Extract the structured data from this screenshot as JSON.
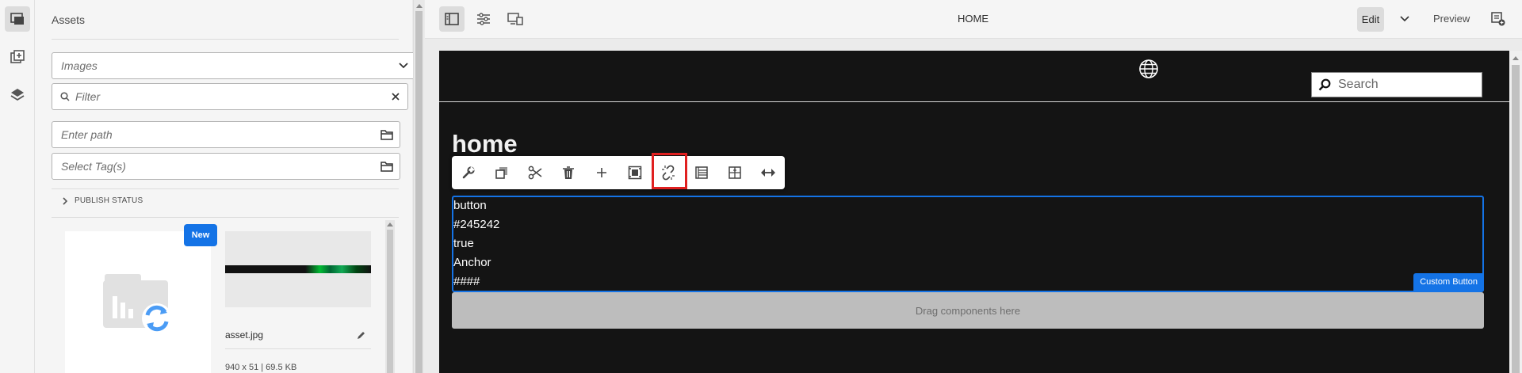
{
  "rail": {
    "items": [
      {
        "icon": "assets-icon",
        "active": true
      },
      {
        "icon": "components-icon",
        "active": false
      },
      {
        "icon": "layers-icon",
        "active": false
      }
    ]
  },
  "panel": {
    "title": "Assets",
    "asset_type": "Images",
    "filter_placeholder": "Filter",
    "path_placeholder": "Enter path",
    "tags_placeholder": "Select Tag(s)",
    "publish_status_label": "PUBLISH STATUS",
    "cards": [
      {
        "badge": "New",
        "thumbnail": "processing"
      },
      {
        "name": "asset.jpg",
        "meta": "940 x 51 | 69.5 KB"
      }
    ]
  },
  "topbar": {
    "page_title": "HOME",
    "edit_label": "Edit",
    "preview_label": "Preview"
  },
  "site": {
    "search_placeholder": "Search",
    "heading": "home",
    "component_lines": [
      "button",
      "#245242",
      "true",
      "Anchor",
      "####"
    ],
    "component_label": "Custom Button",
    "dropzone_label": "Drag components here"
  },
  "toolbar": {
    "tools": [
      "wrench-icon",
      "copy-icon",
      "cut-icon",
      "delete-icon",
      "insert-icon",
      "group-icon",
      "unlink-icon",
      "paragraph-icon",
      "layout-icon",
      "resize-icon"
    ],
    "highlighted": "unlink-icon",
    "highlight_color": "#e02020"
  },
  "colors": {
    "accent": "#1473e6",
    "site_background": "#141414"
  }
}
